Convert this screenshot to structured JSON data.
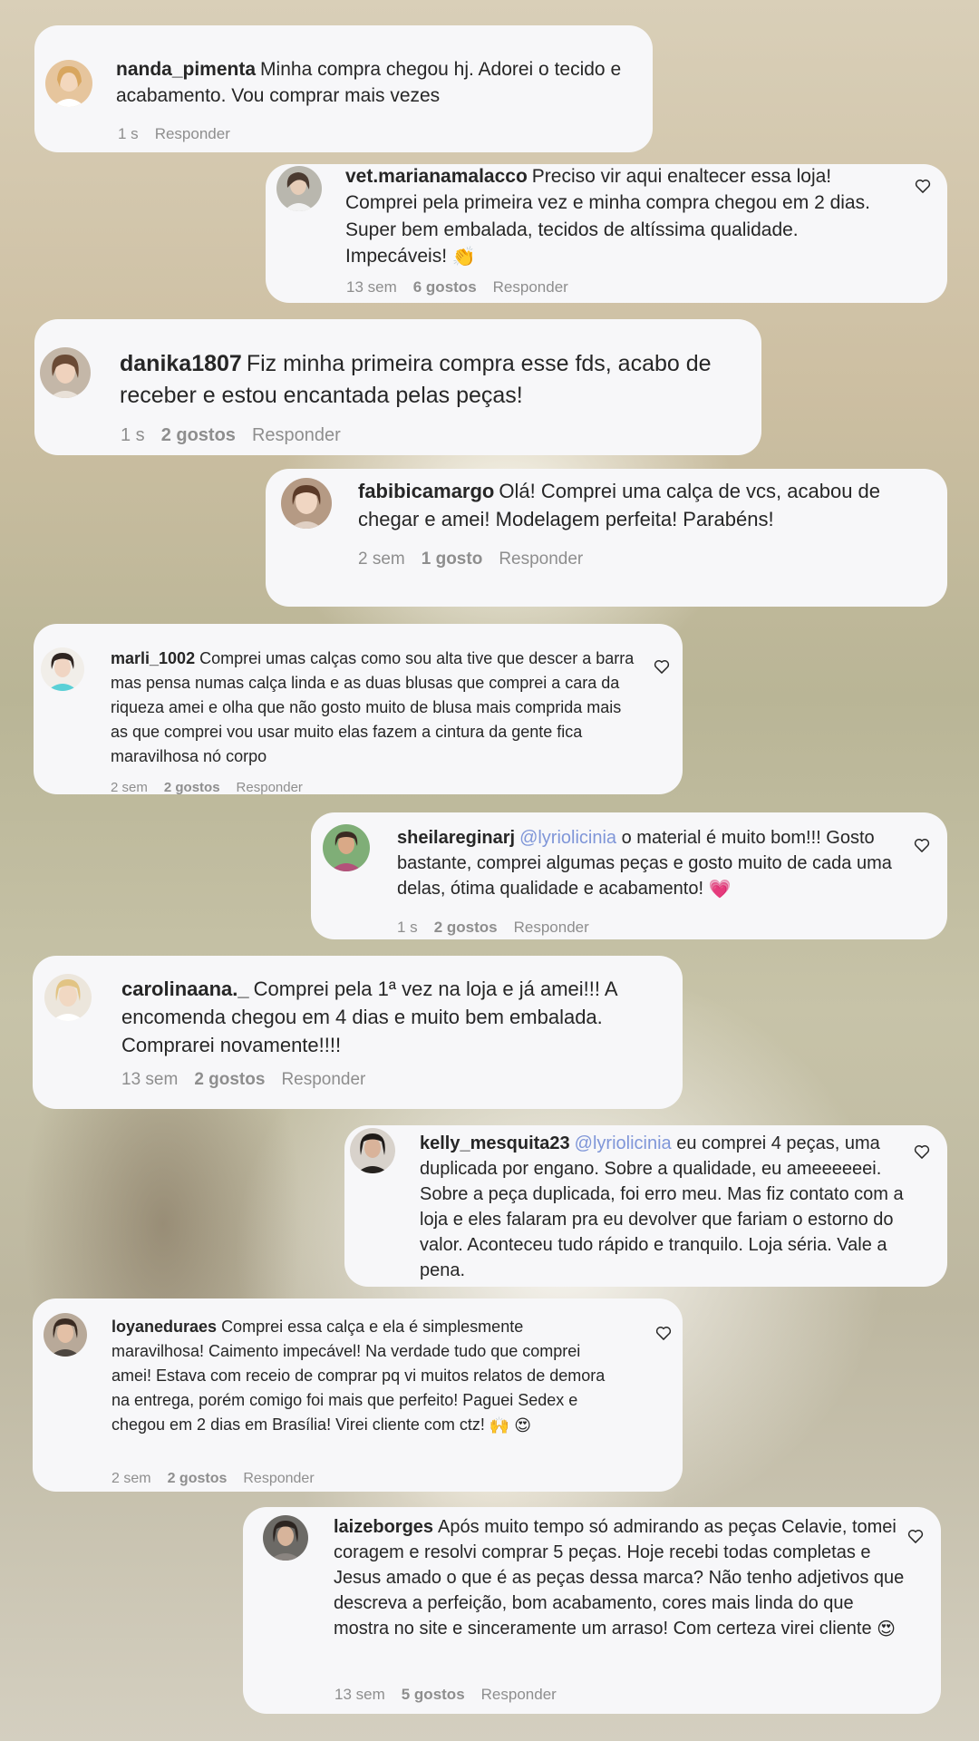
{
  "comments": [
    {
      "username": "nanda_pimenta",
      "text": "Minha compra chegou hj. Adorei o tecido e acabamento. Vou comprar mais vezes",
      "time": "1 s",
      "likes": "",
      "reply": "Responder"
    },
    {
      "username": "vet.marianamalacco",
      "text": "Preciso vir aqui enaltecer essa loja! Comprei pela primeira vez e minha compra chegou em 2 dias. Super bem embalada, tecidos de altíssima qualidade. Impecáveis!",
      "emoji": "👏",
      "time": "13 sem",
      "likes": "6 gostos",
      "reply": "Responder"
    },
    {
      "username": "danika1807",
      "text": "Fiz minha primeira compra esse fds, acabo de receber e estou encantada pelas peças!",
      "time": "1 s",
      "likes": "2 gostos",
      "reply": "Responder"
    },
    {
      "username": "fabibicamargo",
      "text": "Olá! Comprei uma calça de vcs, acabou de chegar e amei! Modelagem perfeita! Parabéns!",
      "time": "2 sem",
      "likes": "1 gosto",
      "reply": "Responder"
    },
    {
      "username": "marli_1002",
      "text": "Comprei umas calças como sou alta tive que descer a barra mas pensa numas calça linda e as duas blusas que comprei a cara da riqueza amei e olha que não gosto muito de blusa mais comprida mais as que comprei vou usar muito elas fazem a cintura da gente fica maravilhosa nó corpo",
      "time": "2 sem",
      "likes": "2 gostos",
      "reply": "Responder"
    },
    {
      "username": "sheilareginarj",
      "mention": "@lyriolicinia",
      "text": "o material é muito bom!!! Gosto bastante, comprei algumas peças e gosto muito de cada uma delas, ótima qualidade e acabamento!",
      "emoji": "💗",
      "time": "1 s",
      "likes": "2 gostos",
      "reply": "Responder"
    },
    {
      "username": "carolinaana._",
      "text": "Comprei pela 1ª vez na loja e já amei!!! A encomenda chegou em 4 dias e muito bem embalada. Comprarei novamente!!!!",
      "time": "13 sem",
      "likes": "2 gostos",
      "reply": "Responder"
    },
    {
      "username": "kelly_mesquita23",
      "mention": "@lyriolicinia",
      "text": "eu comprei 4 peças, uma duplicada por engano. Sobre a qualidade, eu ameeeeeei. Sobre a peça duplicada, foi erro meu. Mas fiz contato com a loja e eles falaram pra eu devolver que fariam o estorno do valor. Aconteceu tudo rápido e tranquilo. Loja séria. Vale a pena.",
      "time": "",
      "likes": "",
      "reply": ""
    },
    {
      "username": "loyaneduraes",
      "text": "Comprei essa calça e ela é simplesmente maravilhosa! Caimento impecável! Na verdade tudo que comprei amei! Estava com receio de comprar pq vi muitos relatos de demora na entrega, porém comigo foi mais que perfeito! Paguei Sedex e chegou em 2 dias em Brasília! Virei cliente com ctz!",
      "emoji": "🙌 😍",
      "time": "2 sem",
      "likes": "2 gostos",
      "reply": "Responder"
    },
    {
      "username": "laizeborges",
      "text": "Após muito tempo só admirando as peças Celavie, tomei coragem e resolvi comprar 5 peças. Hoje recebi todas completas e Jesus amado o que é as peças dessa marca? Não tenho adjetivos que descreva a perfeição, bom acabamento, cores mais linda do que mostra no site e sinceramente um arraso! Com certeza virei cliente",
      "emoji": "😍",
      "time": "13 sem",
      "likes": "5 gostos",
      "reply": "Responder"
    }
  ]
}
